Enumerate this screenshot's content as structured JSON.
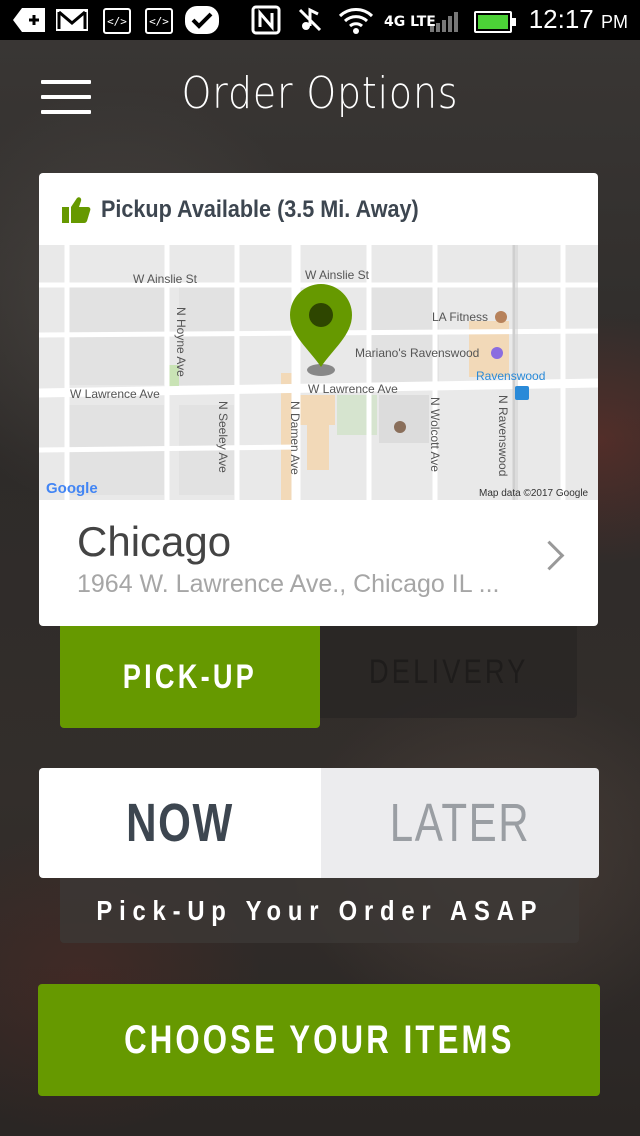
{
  "status_bar": {
    "time": "12:17",
    "ampm": "PM",
    "network": "4G LTE"
  },
  "header": {
    "title": "Order Options"
  },
  "location_card": {
    "availability": "Pickup Available (3.5 Mi. Away)",
    "map": {
      "streets": [
        "W Ainslie St",
        "W Ainslie St",
        "W Lawrence Ave",
        "W Lawrence Ave",
        "N Hoyne Ave",
        "N Seeley Ave",
        "N Damen Ave",
        "N Wolcott Ave",
        "N Ravenswood"
      ],
      "places": [
        "LA Fitness",
        "Mariano's Ravenswood",
        "Ravenswood"
      ],
      "google_logo": "Google",
      "attribution": "Map data ©2017 Google"
    },
    "city": "Chicago",
    "address": "1964 W. Lawrence Ave., Chicago IL ..."
  },
  "order_mode": {
    "pickup_label": "PICK-UP",
    "delivery_label": "DELIVERY",
    "selected": "pickup"
  },
  "timing": {
    "now_label": "NOW",
    "later_label": "LATER",
    "selected": "now",
    "hint": "Pick-Up Your Order ASAP"
  },
  "cta": {
    "label": "CHOOSE YOUR ITEMS"
  },
  "colors": {
    "accent": "#669900",
    "text_dark": "#3d4650"
  }
}
